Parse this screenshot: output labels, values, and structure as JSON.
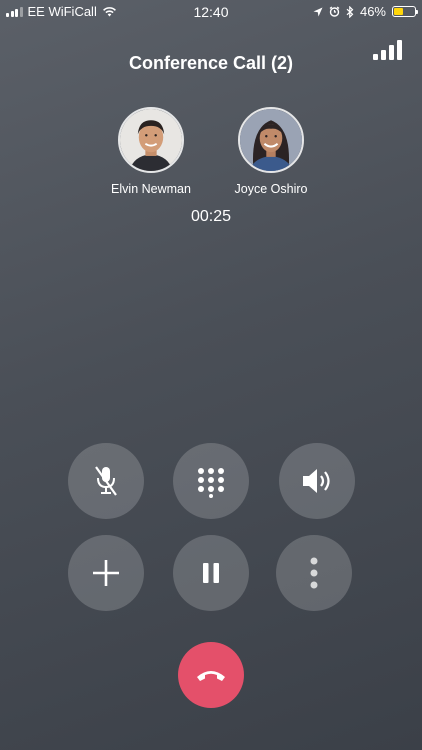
{
  "status_bar": {
    "carrier": "EE WiFiCall",
    "time": "12:40",
    "battery_percent": "46%",
    "battery_level": 0.46,
    "battery_color": "#ffd60a",
    "icons": [
      "cellular-signal-icon",
      "wifi-icon",
      "location-arrow-icon",
      "alarm-icon",
      "bluetooth-icon",
      "battery-icon"
    ]
  },
  "call": {
    "title": "Conference Call (2)",
    "duration": "00:25",
    "participants": [
      {
        "name": "Elvin Newman"
      },
      {
        "name": "Joyce Oshiro"
      }
    ]
  },
  "controls": [
    {
      "name": "mute",
      "icon": "microphone-muted-icon"
    },
    {
      "name": "keypad",
      "icon": "dialpad-icon"
    },
    {
      "name": "speaker",
      "icon": "speaker-icon"
    },
    {
      "name": "add-call",
      "icon": "plus-icon"
    },
    {
      "name": "hold",
      "icon": "pause-icon"
    },
    {
      "name": "more",
      "icon": "more-vertical-icon"
    }
  ],
  "end_call": {
    "icon": "hang-up-icon",
    "color": "#e4506a"
  }
}
